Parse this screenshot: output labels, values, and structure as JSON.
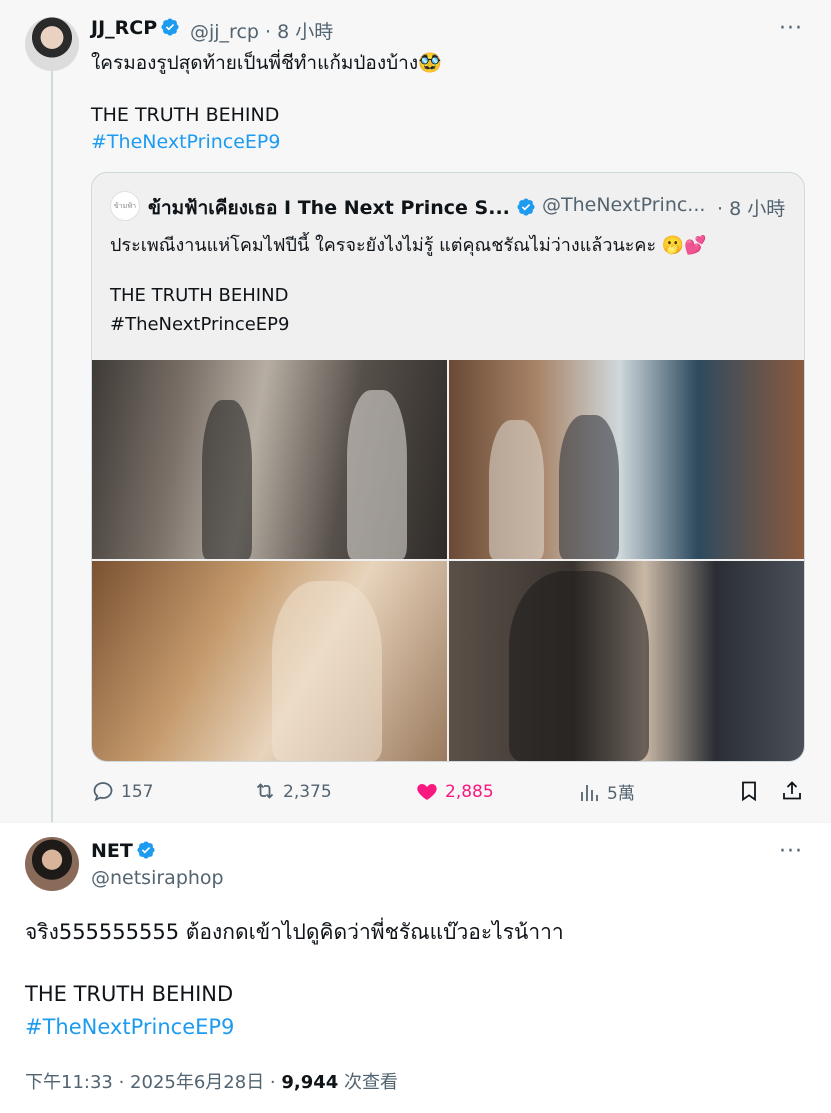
{
  "tweet1": {
    "display_name": "JJ_RCP",
    "handle": "@jj_rcp",
    "time": "· 8 小時",
    "text_line1": "ใครมองรูปสุดท้ายเป็นพี่ชีทำแก้มป่องบ้าง",
    "emoji": "🥸",
    "text_line2": "THE TRUTH BEHIND",
    "hashtag": "#TheNextPrinceEP9",
    "more": "···",
    "stats": {
      "replies": "157",
      "retweets": "2,375",
      "likes": "2,885",
      "views": "5萬"
    }
  },
  "quoted": {
    "logo_text": "ข้ามฟ้า",
    "display_name": "ข้ามฟ้าเคียงเธอ I The Next Prince S...",
    "handle": "@TheNextPrinc...",
    "time": "· 8 小時",
    "text_line1": "ประเพณีงานแห่โคมไฟปีนี้ ใครจะยังไงไม่รู้ แต่คุณชรัณไม่ว่างแล้วนะคะ",
    "emojis": "🫢💕",
    "text_line2": "THE TRUTH BEHIND",
    "hashtag": "#TheNextPrinceEP9"
  },
  "tweet2": {
    "display_name": "NET",
    "handle": "@netsiraphop",
    "more": "···",
    "text_line1": "จริง555555555 ต้องกดเข้าไปดูคิดว่าพี่ชรัณแบ๊วอะไรน้าาา",
    "text_line2": "THE TRUTH BEHIND",
    "hashtag": "#TheNextPrinceEP9",
    "timestamp": "下午11:33 · 2025年6月28日 · ",
    "views_count": "9,944",
    "views_label": " 次查看"
  },
  "colors": {
    "accent": "#1d9bf0",
    "like": "#f91880",
    "muted": "#536471",
    "thread_bg": "#f7f7f7"
  }
}
